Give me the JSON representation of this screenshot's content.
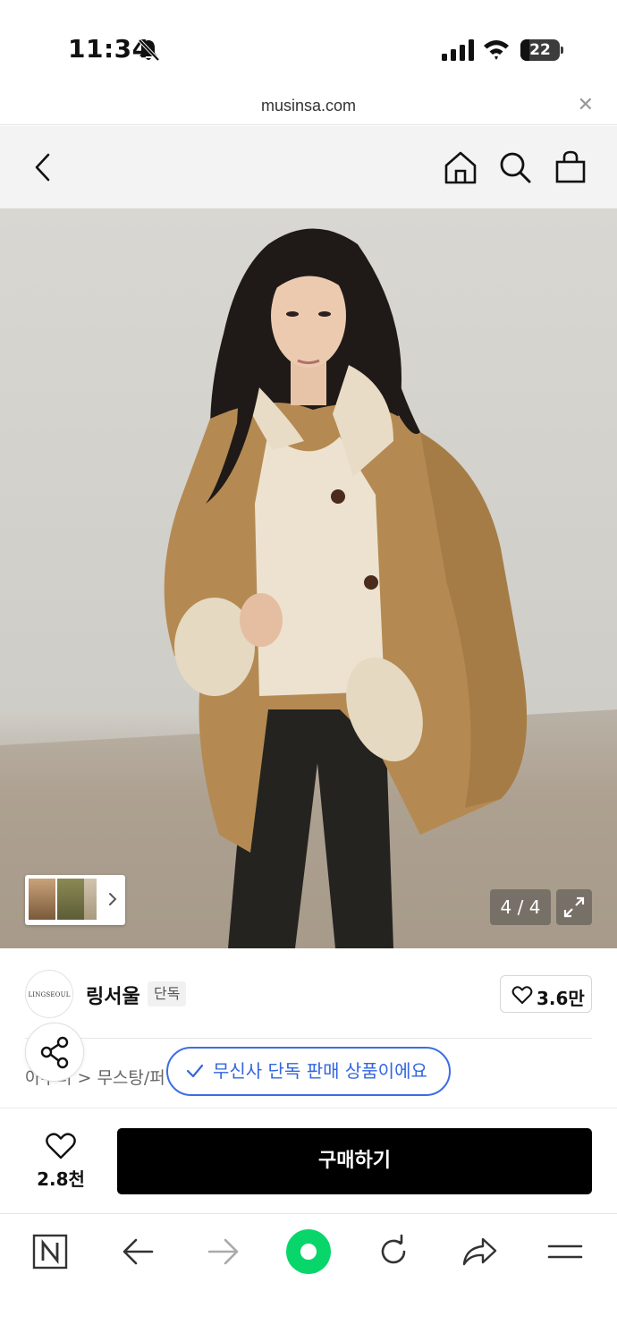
{
  "status_bar": {
    "time": "11:34",
    "battery": "22"
  },
  "browser": {
    "url": "musinsa.com"
  },
  "product": {
    "image_counter": "4 / 4",
    "brand": {
      "logo_text": "LINGSEOUL",
      "name": "링서울",
      "badge": "단독",
      "likes": "3.6만"
    },
    "breadcrumb": "아우터 > 무스탕/퍼",
    "toast": "무신사 단독 판매 상품이에요"
  },
  "purchase": {
    "wish_count": "2.8천",
    "buy_label": "구매하기"
  },
  "colors": {
    "accent_blue": "#3366dd",
    "buy_button": "#000000",
    "naver_green": "#09d66a",
    "header_bg": "#f3f3f3"
  },
  "icons": {
    "header": [
      "back-icon",
      "home-icon",
      "search-icon",
      "shopping-bag-icon"
    ],
    "toolbar": [
      "naver-n-icon",
      "back-arrow-icon",
      "forward-arrow-icon",
      "green-circle-icon",
      "reload-icon",
      "share-arrow-icon",
      "menu-icon"
    ]
  }
}
